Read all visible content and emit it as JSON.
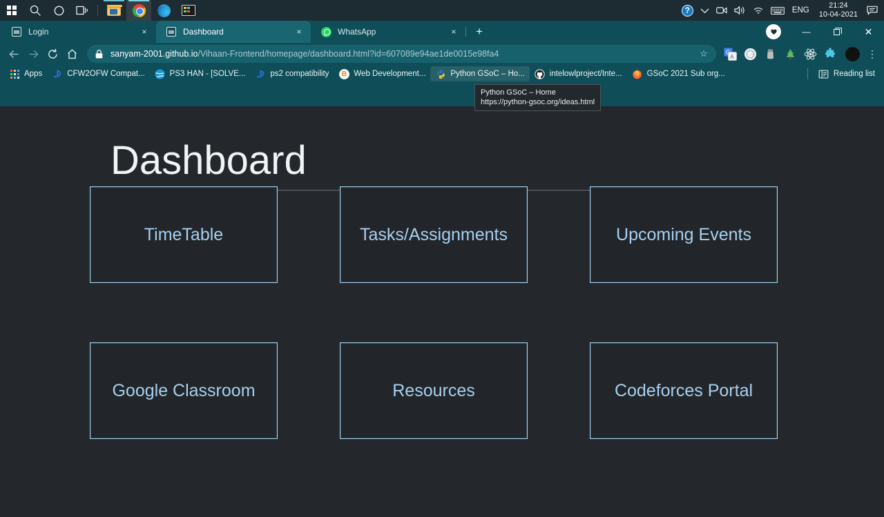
{
  "taskbar": {
    "start_label": "Start",
    "search_label": "Search",
    "cortana_label": "Cortana",
    "taskview_label": "Task View",
    "apps": [
      {
        "name": "File Explorer",
        "icon": "folder-icon",
        "running": true,
        "active": false
      },
      {
        "name": "Google Chrome",
        "icon": "chrome-icon",
        "running": true,
        "active": true
      },
      {
        "name": "Microsoft Edge",
        "icon": "edge-icon",
        "running": false,
        "active": false
      },
      {
        "name": "Virtual Machine Console",
        "icon": "vm-console-icon",
        "running": false,
        "active": false
      }
    ],
    "tray": {
      "help_glyph": "?",
      "chevron_glyph": "⌄",
      "meet_now_label": "Meet Now",
      "volume_label": "Volume",
      "network_label": "Network",
      "keyboard_label": "Touch keyboard",
      "language": "ENG",
      "time": "21:24",
      "date": "10-04-2021",
      "notifications_label": "Notifications"
    }
  },
  "browser": {
    "tabs": [
      {
        "title": "Login",
        "favicon": "page-icon",
        "active": false,
        "close_glyph": "×"
      },
      {
        "title": "Dashboard",
        "favicon": "page-icon",
        "active": true,
        "close_glyph": "×"
      },
      {
        "title": "WhatsApp",
        "favicon": "whatsapp-icon",
        "active": false,
        "close_glyph": "×"
      }
    ],
    "new_tab_glyph": "+",
    "window_controls": {
      "profile_label": "Profile",
      "minimize_glyph": "—",
      "maximize_glyph": "❐",
      "close_glyph": "✕"
    },
    "toolbar": {
      "back_label": "Back",
      "forward_label": "Forward",
      "reload_label": "Reload",
      "home_label": "Home",
      "url_domain": "sanyam-2001.github.io",
      "url_path": "/Vihaan-Frontend/homepage/dashboard.html?id=607089e94ae1de0015e98fa4",
      "star_glyph": "☆",
      "extensions": [
        {
          "name": "google-translate-extension"
        },
        {
          "name": "grammarly-extension"
        },
        {
          "name": "honey-extension"
        },
        {
          "name": "evernote-extension"
        },
        {
          "name": "react-devtools-extension"
        },
        {
          "name": "puzzle-extensions-icon"
        }
      ],
      "avatar_label": "Profile avatar",
      "menu_glyph": "⋮"
    },
    "bookmarks": {
      "apps_label": "Apps",
      "items": [
        {
          "label": "CFW2OFW Compat...",
          "icon": "ps-icon"
        },
        {
          "label": "PS3 HAN - [SOLVE...",
          "icon": "globe-icon"
        },
        {
          "label": "ps2 compatibility",
          "icon": "ps-icon"
        },
        {
          "label": "Web Development...",
          "icon": "b-icon"
        },
        {
          "label": "Python GSoC – Ho...",
          "icon": "python-icon",
          "hover": true
        },
        {
          "label": "intelowlproject/Inte...",
          "icon": "github-icon"
        },
        {
          "label": "GSoC 2021 Sub org...",
          "icon": "firefox-icon"
        }
      ],
      "reading_list_label": "Reading list"
    },
    "tooltip": {
      "title": "Python GSoC – Home",
      "url": "https://python-gsoc.org/ideas.html"
    }
  },
  "page": {
    "title": "Dashboard",
    "accent_color": "#a8d4ef",
    "text_color": "#a7cfee",
    "background_color": "#24282d",
    "cards": [
      {
        "label": "TimeTable"
      },
      {
        "label": "Tasks/Assignments"
      },
      {
        "label": "Upcoming Events"
      },
      {
        "label": "Google Classroom"
      },
      {
        "label": "Resources"
      },
      {
        "label": "Codeforces Portal"
      }
    ]
  }
}
